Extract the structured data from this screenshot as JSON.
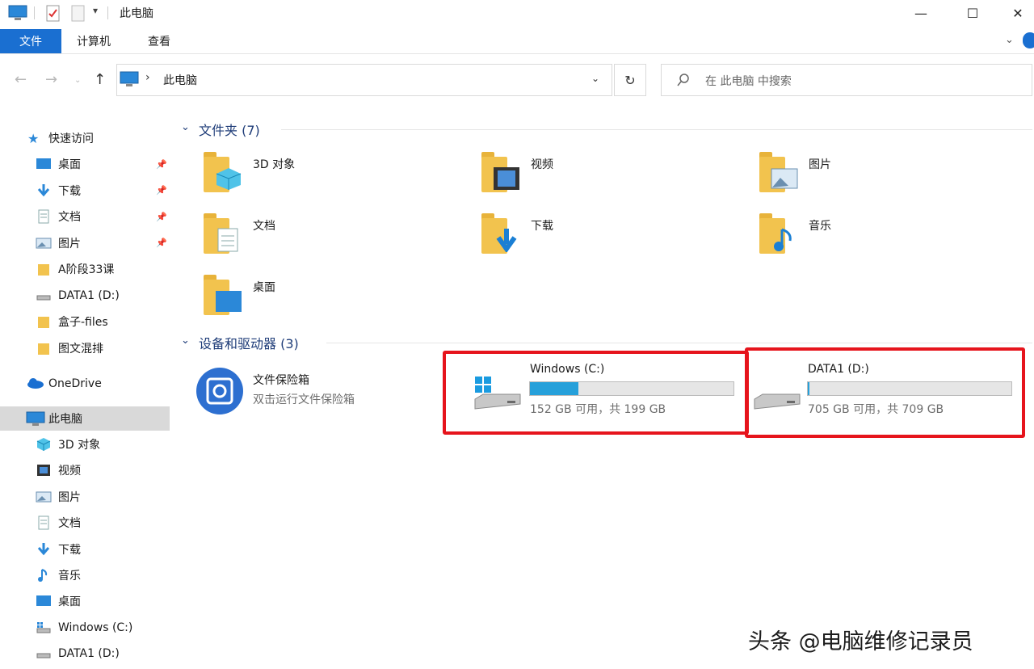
{
  "window": {
    "title": "此电脑",
    "minimize": "—",
    "maximize": "☐",
    "close": "✕"
  },
  "ribbon": {
    "tabs": [
      "文件",
      "计算机",
      "查看"
    ]
  },
  "address": {
    "path": "此电脑",
    "separator": "›",
    "search_placeholder": "在 此电脑 中搜索"
  },
  "sidebar": {
    "quick_access": "快速访问",
    "pinned": [
      {
        "label": "桌面",
        "icon": "desktop-icon",
        "pinned": true
      },
      {
        "label": "下载",
        "icon": "download-icon",
        "pinned": true
      },
      {
        "label": "文档",
        "icon": "document-icon",
        "pinned": true
      },
      {
        "label": "图片",
        "icon": "picture-icon",
        "pinned": true
      },
      {
        "label": "A阶段33课",
        "icon": "folder-icon",
        "pinned": false
      },
      {
        "label": "DATA1 (D:)",
        "icon": "drive-icon",
        "pinned": false
      },
      {
        "label": "盒子-files",
        "icon": "folder-icon",
        "pinned": false
      },
      {
        "label": "图文混排",
        "icon": "folder-icon",
        "pinned": false
      }
    ],
    "onedrive": "OneDrive",
    "this_pc": "此电脑",
    "this_pc_items": [
      {
        "label": "3D 对象",
        "icon": "cube-icon"
      },
      {
        "label": "视频",
        "icon": "video-icon"
      },
      {
        "label": "图片",
        "icon": "picture-icon"
      },
      {
        "label": "文档",
        "icon": "document-icon"
      },
      {
        "label": "下载",
        "icon": "download-icon"
      },
      {
        "label": "音乐",
        "icon": "music-icon"
      },
      {
        "label": "桌面",
        "icon": "desktop-icon"
      },
      {
        "label": "Windows (C:)",
        "icon": "windows-drive-icon"
      },
      {
        "label": "DATA1 (D:)",
        "icon": "drive-icon"
      }
    ]
  },
  "folders": {
    "title": "文件夹 (7)",
    "items": [
      {
        "label": "3D 对象",
        "icon": "cube-folder-icon"
      },
      {
        "label": "视频",
        "icon": "video-folder-icon"
      },
      {
        "label": "图片",
        "icon": "picture-folder-icon"
      },
      {
        "label": "文档",
        "icon": "document-folder-icon"
      },
      {
        "label": "下载",
        "icon": "download-folder-icon"
      },
      {
        "label": "音乐",
        "icon": "music-folder-icon"
      },
      {
        "label": "桌面",
        "icon": "desktop-folder-icon"
      }
    ]
  },
  "devices": {
    "title": "设备和驱动器 (3)",
    "vault": {
      "name": "文件保险箱",
      "desc": "双击运行文件保险箱"
    },
    "drives": [
      {
        "name": "Windows (C:)",
        "free": "152 GB 可用，共 199 GB",
        "used_fraction": 0.24,
        "accent": "#26a0da"
      },
      {
        "name": "DATA1 (D:)",
        "free": "705 GB 可用，共 709 GB",
        "used_fraction": 0.006,
        "accent": "#26a0da"
      }
    ]
  },
  "watermark": "头条 @电脑维修记录员",
  "colors": {
    "file_tab": "#1a6fd1",
    "highlight": "#e6141c",
    "selected": "#d9d9d9"
  }
}
